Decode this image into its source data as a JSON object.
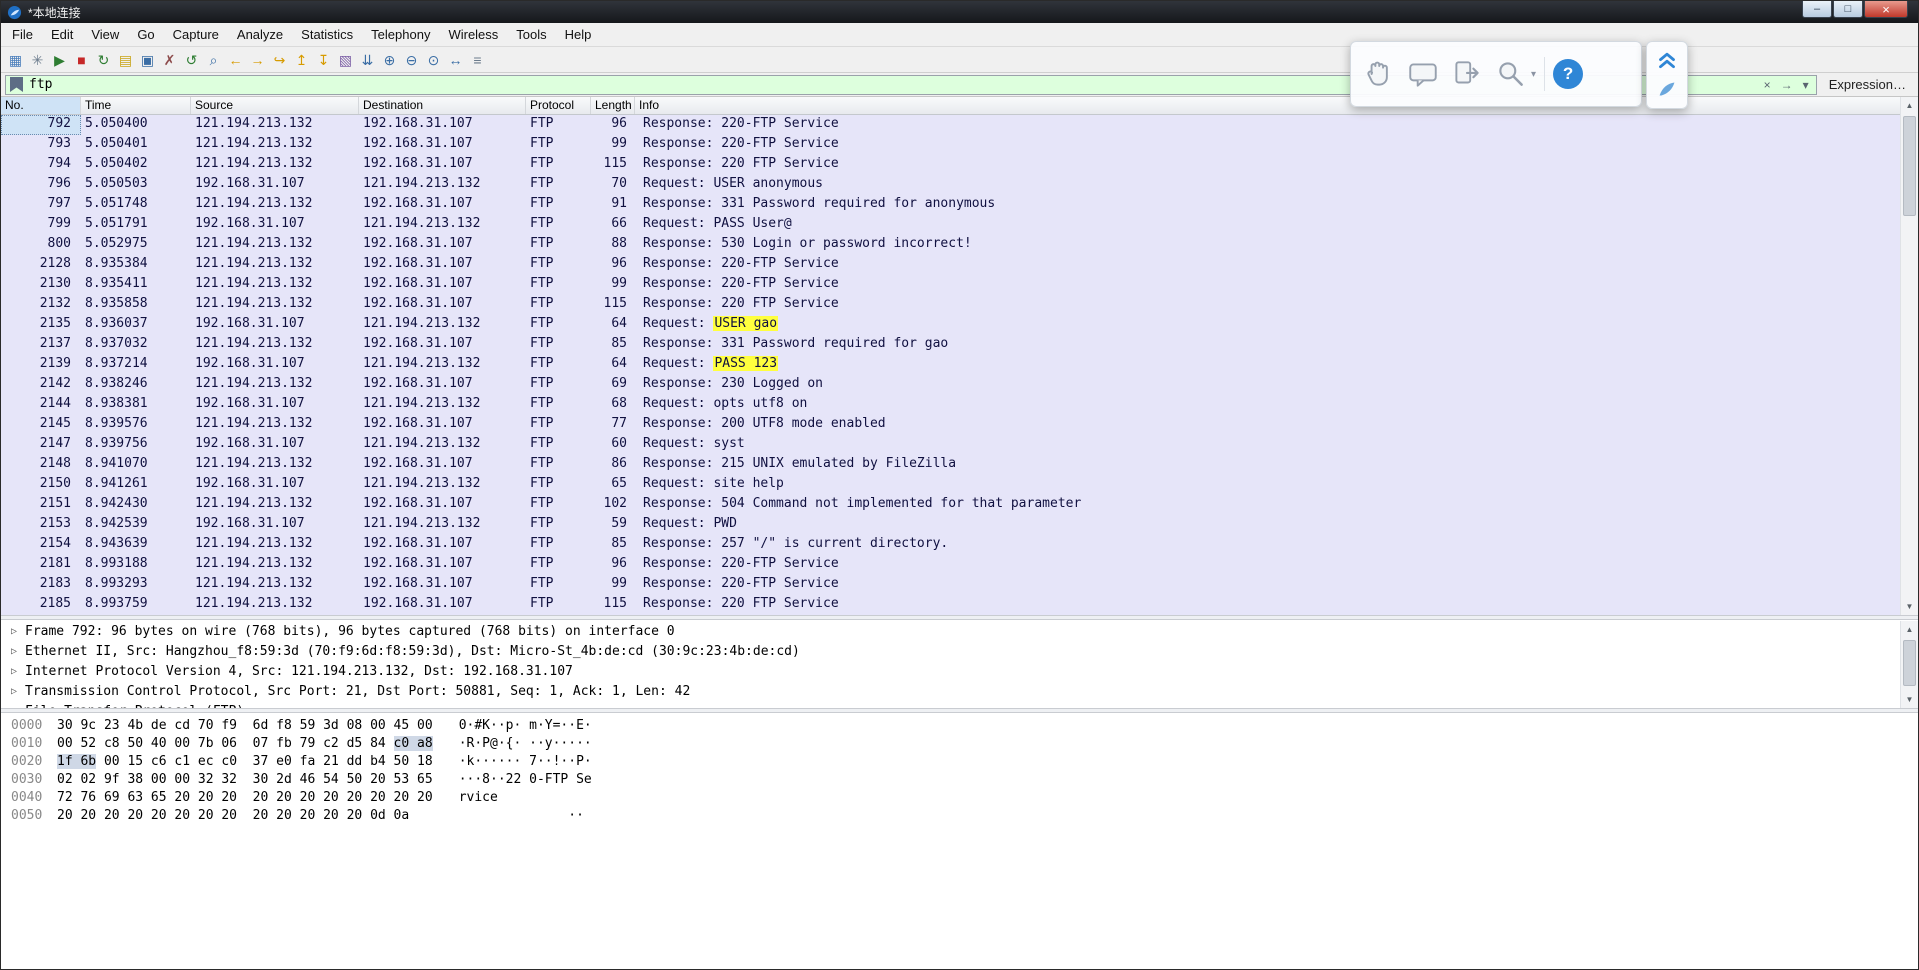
{
  "window": {
    "title": "*本地连接"
  },
  "window_controls": {
    "minimize_glyph": "–",
    "maximize_glyph": "□",
    "close_glyph": "×"
  },
  "menu": {
    "items": [
      {
        "name": "menu-file",
        "label": "File"
      },
      {
        "name": "menu-edit",
        "label": "Edit"
      },
      {
        "name": "menu-view",
        "label": "View"
      },
      {
        "name": "menu-go",
        "label": "Go"
      },
      {
        "name": "menu-capture",
        "label": "Capture"
      },
      {
        "name": "menu-analyze",
        "label": "Analyze"
      },
      {
        "name": "menu-statistics",
        "label": "Statistics"
      },
      {
        "name": "menu-telephony",
        "label": "Telephony"
      },
      {
        "name": "menu-wireless",
        "label": "Wireless"
      },
      {
        "name": "menu-tools",
        "label": "Tools"
      },
      {
        "name": "menu-help",
        "label": "Help"
      }
    ]
  },
  "toolbar": {
    "icons": [
      {
        "name": "list-interfaces-icon",
        "glyph": "▦",
        "style": "color:#4a7ebb"
      },
      {
        "name": "capture-options-icon",
        "glyph": "✳",
        "style": "color:#6b7b8c"
      },
      {
        "name": "start-capture-icon",
        "glyph": "▶",
        "style": "color:#2e7d32"
      },
      {
        "name": "stop-capture-icon",
        "glyph": "■",
        "style": "color:#c62828"
      },
      {
        "name": "restart-capture-icon",
        "glyph": "↻",
        "style": "color:#2e7d32"
      },
      {
        "name": "open-file-icon",
        "glyph": "▤",
        "style": "color:#c8a415"
      },
      {
        "name": "save-file-icon",
        "glyph": "▣",
        "style": "color:#3b6ea5"
      },
      {
        "name": "close-file-icon",
        "glyph": "✗",
        "style": "color:#8c4a4a"
      },
      {
        "name": "reload-file-icon",
        "glyph": "↺",
        "style": "color:#2e7d32"
      },
      {
        "name": "find-packet-icon",
        "glyph": "⌕",
        "style": "color:#3b6ea5"
      },
      {
        "name": "go-back-icon",
        "glyph": "←",
        "style": "color:#d79b00"
      },
      {
        "name": "go-forward-icon",
        "glyph": "→",
        "style": "color:#d79b00"
      },
      {
        "name": "go-to-packet-icon",
        "glyph": "↪",
        "style": "color:#d79b00"
      },
      {
        "name": "go-first-packet-icon",
        "glyph": "↥",
        "style": "color:#d79b00"
      },
      {
        "name": "go-last-packet-icon",
        "glyph": "↧",
        "style": "color:#d79b00"
      },
      {
        "name": "colorize-icon",
        "glyph": "▧",
        "style": "color:#7b5ea5"
      },
      {
        "name": "autoscroll-icon",
        "glyph": "⇊",
        "style": "color:#3b6ea5"
      },
      {
        "name": "zoom-in-icon",
        "glyph": "⊕",
        "style": "color:#3b6ea5"
      },
      {
        "name": "zoom-out-icon",
        "glyph": "⊖",
        "style": "color:#3b6ea5"
      },
      {
        "name": "zoom-100-icon",
        "glyph": "⊙",
        "style": "color:#3b6ea5"
      },
      {
        "name": "resize-columns-icon",
        "glyph": "↔",
        "style": "color:#3b6ea5"
      },
      {
        "name": "display-filters-icon",
        "glyph": "≡",
        "style": "color:#6b7b8c"
      }
    ]
  },
  "filter": {
    "value": "ftp",
    "clear_glyph": "×",
    "apply_glyph": "→",
    "dropdown_glyph": "▾",
    "expression_label": "Expression…"
  },
  "packet_list": {
    "columns": [
      {
        "name": "col-no",
        "label": "No.",
        "cls": "c-no"
      },
      {
        "name": "col-time",
        "label": "Time",
        "cls": "c-time"
      },
      {
        "name": "col-source",
        "label": "Source",
        "cls": "c-src"
      },
      {
        "name": "col-destination",
        "label": "Destination",
        "cls": "c-dst"
      },
      {
        "name": "col-protocol",
        "label": "Protocol",
        "cls": "c-proto"
      },
      {
        "name": "col-length",
        "label": "Length",
        "cls": "c-len"
      },
      {
        "name": "col-info",
        "label": "Info",
        "cls": "c-info"
      }
    ],
    "rows": [
      {
        "no": "792",
        "time": "5.050400",
        "src": "121.194.213.132",
        "dst": "192.168.31.107",
        "proto": "FTP",
        "len": "96",
        "info": "Response: 220-FTP Service",
        "hl": ""
      },
      {
        "no": "793",
        "time": "5.050401",
        "src": "121.194.213.132",
        "dst": "192.168.31.107",
        "proto": "FTP",
        "len": "99",
        "info": "Response: 220-FTP Service",
        "hl": ""
      },
      {
        "no": "794",
        "time": "5.050402",
        "src": "121.194.213.132",
        "dst": "192.168.31.107",
        "proto": "FTP",
        "len": "115",
        "info": "Response: 220 FTP Service",
        "hl": ""
      },
      {
        "no": "796",
        "time": "5.050503",
        "src": "192.168.31.107",
        "dst": "121.194.213.132",
        "proto": "FTP",
        "len": "70",
        "info": "Request: USER anonymous",
        "hl": ""
      },
      {
        "no": "797",
        "time": "5.051748",
        "src": "121.194.213.132",
        "dst": "192.168.31.107",
        "proto": "FTP",
        "len": "91",
        "info": "Response: 331 Password required for anonymous",
        "hl": ""
      },
      {
        "no": "799",
        "time": "5.051791",
        "src": "192.168.31.107",
        "dst": "121.194.213.132",
        "proto": "FTP",
        "len": "66",
        "info": "Request: PASS User@",
        "hl": ""
      },
      {
        "no": "800",
        "time": "5.052975",
        "src": "121.194.213.132",
        "dst": "192.168.31.107",
        "proto": "FTP",
        "len": "88",
        "info": "Response: 530 Login or password incorrect!",
        "hl": ""
      },
      {
        "no": "2128",
        "time": "8.935384",
        "src": "121.194.213.132",
        "dst": "192.168.31.107",
        "proto": "FTP",
        "len": "96",
        "info": "Response: 220-FTP Service",
        "hl": ""
      },
      {
        "no": "2130",
        "time": "8.935411",
        "src": "121.194.213.132",
        "dst": "192.168.31.107",
        "proto": "FTP",
        "len": "99",
        "info": "Response: 220-FTP Service",
        "hl": ""
      },
      {
        "no": "2132",
        "time": "8.935858",
        "src": "121.194.213.132",
        "dst": "192.168.31.107",
        "proto": "FTP",
        "len": "115",
        "info": "Response: 220 FTP Service",
        "hl": ""
      },
      {
        "no": "2135",
        "time": "8.936037",
        "src": "192.168.31.107",
        "dst": "121.194.213.132",
        "proto": "FTP",
        "len": "64",
        "info": "Request: ",
        "hl": "USER gao"
      },
      {
        "no": "2137",
        "time": "8.937032",
        "src": "121.194.213.132",
        "dst": "192.168.31.107",
        "proto": "FTP",
        "len": "85",
        "info": "Response: 331 Password required for gao",
        "hl": ""
      },
      {
        "no": "2139",
        "time": "8.937214",
        "src": "192.168.31.107",
        "dst": "121.194.213.132",
        "proto": "FTP",
        "len": "64",
        "info": "Request: ",
        "hl": "PASS 123"
      },
      {
        "no": "2142",
        "time": "8.938246",
        "src": "121.194.213.132",
        "dst": "192.168.31.107",
        "proto": "FTP",
        "len": "69",
        "info": "Response: 230 Logged on",
        "hl": ""
      },
      {
        "no": "2144",
        "time": "8.938381",
        "src": "192.168.31.107",
        "dst": "121.194.213.132",
        "proto": "FTP",
        "len": "68",
        "info": "Request: opts utf8 on",
        "hl": ""
      },
      {
        "no": "2145",
        "time": "8.939576",
        "src": "121.194.213.132",
        "dst": "192.168.31.107",
        "proto": "FTP",
        "len": "77",
        "info": "Response: 200 UTF8 mode enabled",
        "hl": ""
      },
      {
        "no": "2147",
        "time": "8.939756",
        "src": "192.168.31.107",
        "dst": "121.194.213.132",
        "proto": "FTP",
        "len": "60",
        "info": "Request: syst",
        "hl": ""
      },
      {
        "no": "2148",
        "time": "8.941070",
        "src": "121.194.213.132",
        "dst": "192.168.31.107",
        "proto": "FTP",
        "len": "86",
        "info": "Response: 215 UNIX emulated by FileZilla",
        "hl": ""
      },
      {
        "no": "2150",
        "time": "8.941261",
        "src": "192.168.31.107",
        "dst": "121.194.213.132",
        "proto": "FTP",
        "len": "65",
        "info": "Request: site help",
        "hl": ""
      },
      {
        "no": "2151",
        "time": "8.942430",
        "src": "121.194.213.132",
        "dst": "192.168.31.107",
        "proto": "FTP",
        "len": "102",
        "info": "Response: 504 Command not implemented for that parameter",
        "hl": ""
      },
      {
        "no": "2153",
        "time": "8.942539",
        "src": "192.168.31.107",
        "dst": "121.194.213.132",
        "proto": "FTP",
        "len": "59",
        "info": "Request: PWD",
        "hl": ""
      },
      {
        "no": "2154",
        "time": "8.943639",
        "src": "121.194.213.132",
        "dst": "192.168.31.107",
        "proto": "FTP",
        "len": "85",
        "info": "Response: 257 \"/\" is current directory.",
        "hl": ""
      },
      {
        "no": "2181",
        "time": "8.993188",
        "src": "121.194.213.132",
        "dst": "192.168.31.107",
        "proto": "FTP",
        "len": "96",
        "info": "Response: 220-FTP Service",
        "hl": ""
      },
      {
        "no": "2183",
        "time": "8.993293",
        "src": "121.194.213.132",
        "dst": "192.168.31.107",
        "proto": "FTP",
        "len": "99",
        "info": "Response: 220-FTP Service",
        "hl": ""
      },
      {
        "no": "2185",
        "time": "8.993759",
        "src": "121.194.213.132",
        "dst": "192.168.31.107",
        "proto": "FTP",
        "len": "115",
        "info": "Response: 220 FTP Service",
        "hl": ""
      }
    ]
  },
  "details": {
    "lines": [
      {
        "glyph": "▷",
        "text": "Frame 792: 96 bytes on wire (768 bits), 96 bytes captured (768 bits) on interface 0"
      },
      {
        "glyph": "▷",
        "text": "Ethernet II, Src: Hangzhou_f8:59:3d (70:f9:6d:f8:59:3d), Dst: Micro-St_4b:de:cd (30:9c:23:4b:de:cd)"
      },
      {
        "glyph": "▷",
        "text": "Internet Protocol Version 4, Src: 121.194.213.132, Dst: 192.168.31.107"
      },
      {
        "glyph": "▷",
        "text": "Transmission Control Protocol, Src Port: 21, Dst Port: 50881, Seq: 1, Ack: 1, Len: 42"
      },
      {
        "glyph": "▷",
        "text": "File Transfer Protocol (FTP)"
      }
    ]
  },
  "hex": {
    "lines": [
      {
        "off": "0000",
        "pre": "30 9c 23 4b de cd 70 f9  6d f8 59 3d 08 00 45 00",
        "hl": "",
        "post": "",
        "ascii": "0·#K··p· m·Y=··E·"
      },
      {
        "off": "0010",
        "pre": "00 52 c8 50 40 00 7b 06  07 fb 79 c2 d5 84 ",
        "hl": "c0 a8",
        "post": "",
        "ascii": "·R·P@·{· ··y·····"
      },
      {
        "off": "0020",
        "pre": "",
        "hl": "1f 6b",
        "post": " 00 15 c6 c1 ec c0  37 e0 fa 21 dd b4 50 18",
        "ascii": "·k······ 7··!··P·"
      },
      {
        "off": "0030",
        "pre": "02 02 9f 38 00 00 32 32  30 2d 46 54 50 20 53 65",
        "hl": "",
        "post": "",
        "ascii": "···8··22 0-FTP Se"
      },
      {
        "off": "0040",
        "pre": "72 76 69 63 65 20 20 20  20 20 20 20 20 20 20 20",
        "hl": "",
        "post": "",
        "ascii": "rvice"
      },
      {
        "off": "0050",
        "pre": "20 20 20 20 20 20 20 20  20 20 20 20 20 0d 0a   ",
        "hl": "",
        "post": "",
        "ascii": "              ··"
      }
    ]
  },
  "scrollbar": {
    "up_glyph": "▲",
    "down_glyph": "▼"
  },
  "overlay": {
    "help_glyph": "?",
    "dropdown_glyph": "▾"
  },
  "colors": {
    "ftp_row_bg": "#e6e5f9",
    "search_highlight": "#ffff3e",
    "filter_valid_bg": "#ddffdd",
    "titlebar_bg": "#1b1e24",
    "close_button_red": "#c0392b",
    "selected_cell_blue": "#cfe3f6",
    "hex_select_bg": "#cfd8e6",
    "accent_blue": "#2f86d6"
  }
}
